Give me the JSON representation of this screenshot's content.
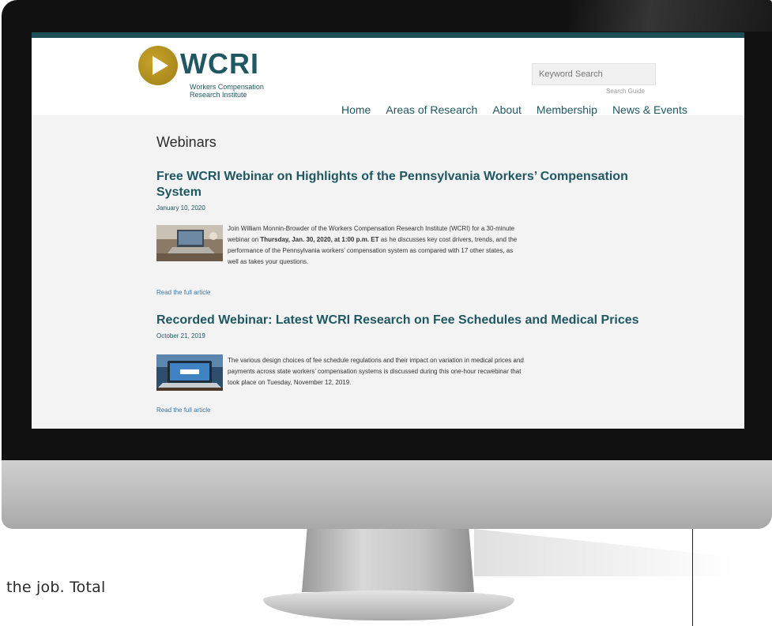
{
  "site": {
    "logo_word": "WCRI",
    "logo_sub_line1": "Workers Compensation",
    "logo_sub_line2": "Research Institute",
    "search_placeholder": "Keyword Search",
    "search_guide": "Search Guide"
  },
  "nav": {
    "items": [
      {
        "label": "Home"
      },
      {
        "label": "Areas of Research"
      },
      {
        "label": "About"
      },
      {
        "label": "Membership"
      },
      {
        "label": "News & Events"
      }
    ]
  },
  "page": {
    "title": "Webinars"
  },
  "articles": [
    {
      "title_line1": "Free WCRI Webinar on Highlights of the Pennsylvania Workers’ Compensation",
      "title_line2": "System",
      "date": "January 10, 2020",
      "body_1": "Join William Monnin-Browder of the Workers Compensation Research Institute (WCRI) for a 30-minute",
      "body_2a": "webinar on ",
      "body_2b": "Thursday, Jan. 30, 2020, at 1:00 p.m. ET",
      "body_2c": " as he discusses key cost drivers, trends, and the",
      "body_3": "performance of the Pennsylvania workers’ compensation system as compared with 17 other states, as",
      "body_4": "well as takes your questions.",
      "read_more": "Read the full article"
    },
    {
      "title_line1": "Recorded Webinar: Latest WCRI Research on Fee Schedules and Medical Prices",
      "date": "October 21, 2019",
      "body_1": "The various design choices of fee schedule regulations and their impact on variation in medical prices and",
      "body_2": "payments across state workers’ compensation systems is discussed during this one-hour recwebinar that",
      "body_3": "took place on Tuesday, November 12, 2019.",
      "read_more": "Read the full article"
    }
  ],
  "document": {
    "bottom_text": "the job. Total"
  }
}
